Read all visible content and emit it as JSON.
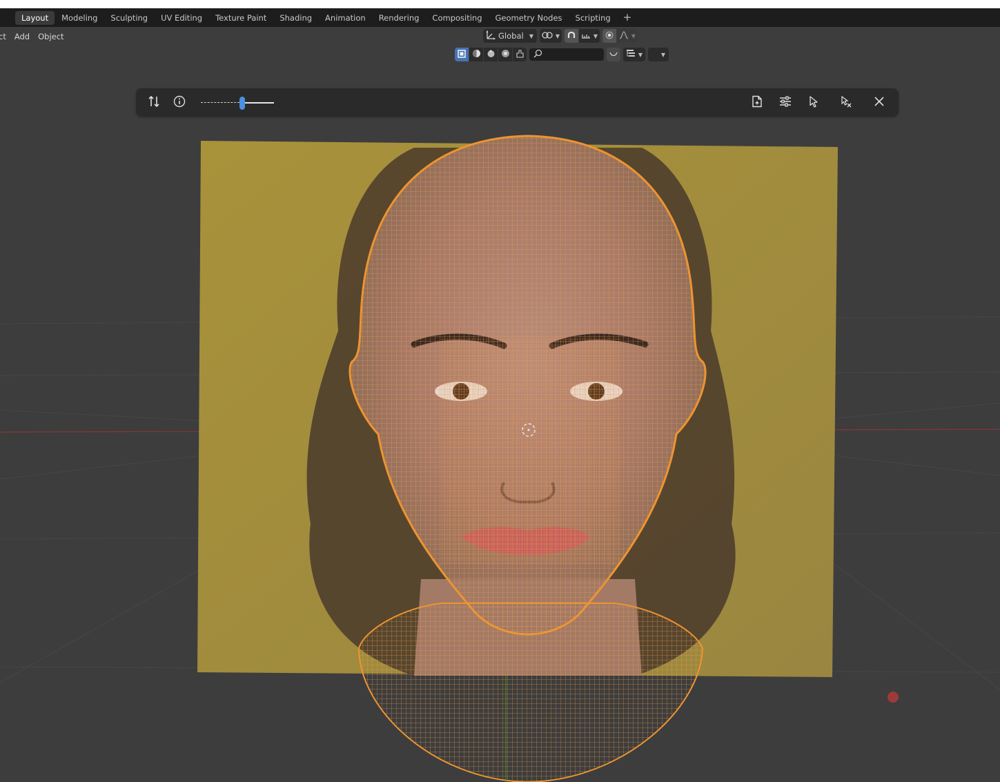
{
  "workspace_tabs": [
    "Layout",
    "Modeling",
    "Sculpting",
    "UV Editing",
    "Texture Paint",
    "Shading",
    "Animation",
    "Rendering",
    "Compositing",
    "Geometry Nodes",
    "Scripting"
  ],
  "active_tab": "Layout",
  "add_tab_glyph": "+",
  "header_menu": {
    "select_partial": "ct",
    "add": "Add",
    "object": "Object"
  },
  "header_tools": {
    "transform_orientation": "Global",
    "search_placeholder": "",
    "icons": [
      "transform-orientation-icon",
      "pivot-icon",
      "snap-icon",
      "snap-increment-icon",
      "proportional-edit-icon",
      "proportional-falloff-icon",
      "solid-shading-icon",
      "material-shading-icon",
      "rendered-shading-icon",
      "wireframe-shading-icon",
      "overlay-icon",
      "search-icon",
      "gizmo-icon",
      "view-layer-icon"
    ]
  },
  "floating_toolbar": {
    "slider_value": 0.57,
    "icons": [
      "swap-icon",
      "info-icon",
      "new-file-icon",
      "settings-icon",
      "select-cursor-icon",
      "pin-icon",
      "close-icon"
    ]
  },
  "colors": {
    "viewport_bg": "#3d3d3d",
    "tabbar_bg": "#1d1d1d",
    "active_blue": "#4772b3",
    "slider_thumb": "#4a8fe0",
    "wireframe": "#e8922c",
    "reference_plane": "#b09b3a",
    "x_axis": "#a23a3a",
    "y_axis": "#5f9a2f"
  }
}
